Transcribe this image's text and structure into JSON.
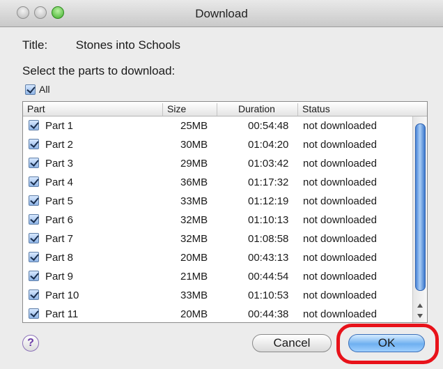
{
  "window": {
    "title": "Download"
  },
  "info": {
    "title_label": "Title:",
    "title_value": "Stones into Schools",
    "instruction": "Select the parts to download:"
  },
  "all_checkbox": {
    "label": "All",
    "checked": true
  },
  "columns": {
    "part": "Part",
    "size": "Size",
    "duration": "Duration",
    "status": "Status"
  },
  "rows": [
    {
      "part": "Part 1",
      "size": "25MB",
      "duration": "00:54:48",
      "status": "not downloaded",
      "checked": true
    },
    {
      "part": "Part 2",
      "size": "30MB",
      "duration": "01:04:20",
      "status": "not downloaded",
      "checked": true
    },
    {
      "part": "Part 3",
      "size": "29MB",
      "duration": "01:03:42",
      "status": "not downloaded",
      "checked": true
    },
    {
      "part": "Part 4",
      "size": "36MB",
      "duration": "01:17:32",
      "status": "not downloaded",
      "checked": true
    },
    {
      "part": "Part 5",
      "size": "33MB",
      "duration": "01:12:19",
      "status": "not downloaded",
      "checked": true
    },
    {
      "part": "Part 6",
      "size": "32MB",
      "duration": "01:10:13",
      "status": "not downloaded",
      "checked": true
    },
    {
      "part": "Part 7",
      "size": "32MB",
      "duration": "01:08:58",
      "status": "not downloaded",
      "checked": true
    },
    {
      "part": "Part 8",
      "size": "20MB",
      "duration": "00:43:13",
      "status": "not downloaded",
      "checked": true
    },
    {
      "part": "Part 9",
      "size": "21MB",
      "duration": "00:44:54",
      "status": "not downloaded",
      "checked": true
    },
    {
      "part": "Part 10",
      "size": "33MB",
      "duration": "01:10:53",
      "status": "not downloaded",
      "checked": true
    },
    {
      "part": "Part 11",
      "size": "20MB",
      "duration": "00:44:38",
      "status": "not downloaded",
      "checked": true
    }
  ],
  "buttons": {
    "help": "?",
    "cancel": "Cancel",
    "ok": "OK"
  },
  "icons": {
    "help": "help-icon",
    "check": "checkmark-icon"
  },
  "colors": {
    "accent": "#6fb0f0",
    "highlight": "#e8121a"
  }
}
